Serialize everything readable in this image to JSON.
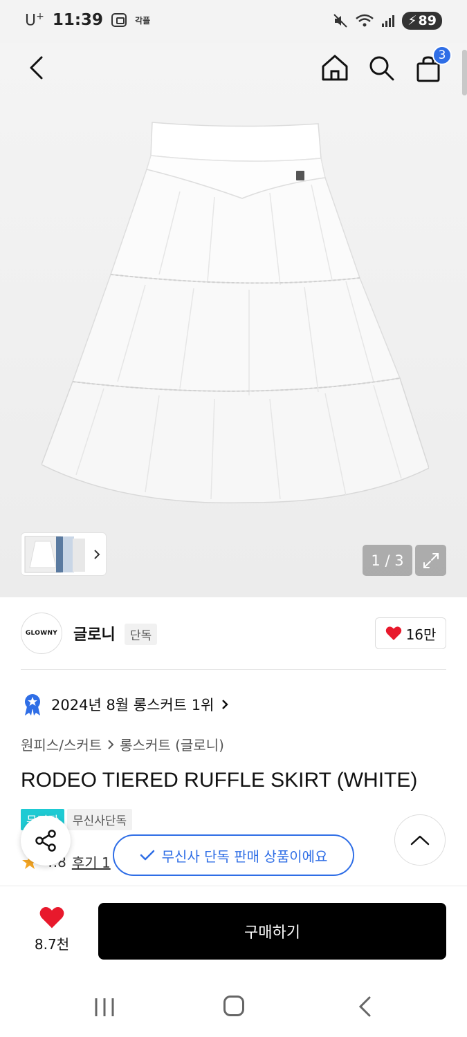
{
  "status_bar": {
    "carrier": "U",
    "carrier_sup": "+",
    "time": "11:39",
    "app_label": "각플",
    "battery": "89"
  },
  "top_nav": {
    "back_icon": "chevron-left-icon",
    "home_icon": "home-icon",
    "search_icon": "search-icon",
    "cart_icon": "shopping-bag-icon",
    "cart_count": "3"
  },
  "gallery": {
    "counter": "1 / 3",
    "expand_icon": "expand-icon"
  },
  "brand": {
    "logo_text": "GLOWNY",
    "name": "글로니",
    "tag": "단독",
    "likes": "16만"
  },
  "ranking": {
    "text": "2024년 8월 롱스커트 1위"
  },
  "breadcrumb": {
    "category": "원피스/스커트",
    "subcategory": "롱스커트 (글로니)"
  },
  "product": {
    "title": "RODEO TIERED RUFFLE SKIRT (WHITE)",
    "badges": [
      "무진장",
      "무신사단독"
    ],
    "rating": "4.8",
    "reviews_label": "후기 1"
  },
  "toast": {
    "text": "무신사 단독 판매 상품이에요"
  },
  "bottom_bar": {
    "wish_count": "8.7천",
    "buy_label": "구매하기"
  },
  "colors": {
    "accent_blue": "#2f6ee6",
    "heart_red": "#e8192c",
    "badge_teal": "#1ecad3",
    "buy_black": "#000000"
  }
}
